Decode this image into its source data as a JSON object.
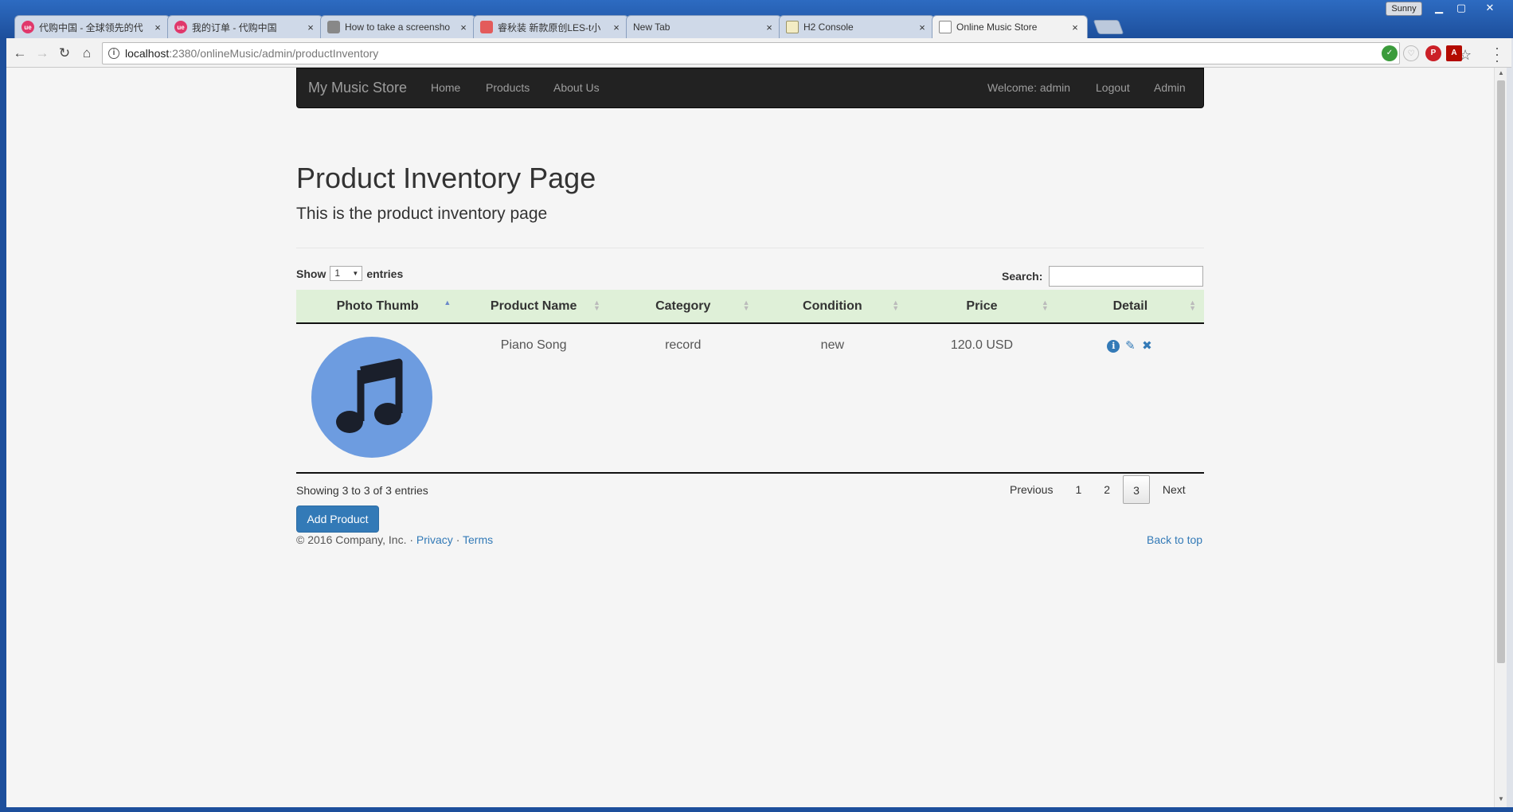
{
  "browser": {
    "tabs": [
      {
        "title": "代购中国 - 全球领先的代",
        "favicon": "red"
      },
      {
        "title": "我的订单 - 代购中国",
        "favicon": "red"
      },
      {
        "title": "How to take a screensho",
        "favicon": "grey"
      },
      {
        "title": "睿秋装 新款原创LES-t小",
        "favicon": "pink"
      },
      {
        "title": "New Tab",
        "favicon": "none"
      },
      {
        "title": "H2 Console",
        "favicon": "gdoc"
      },
      {
        "title": "Online Music Store",
        "favicon": "site",
        "active": true
      }
    ],
    "tab_close": "×",
    "user_badge": "Sunny",
    "url_host": "localhost",
    "url_rest": ":2380/onlineMusic/admin/productInventory"
  },
  "navbar": {
    "brand": "My Music Store",
    "links": [
      "Home",
      "Products",
      "About Us"
    ],
    "right_links": [
      "Welcome: admin",
      "Logout",
      "Admin"
    ]
  },
  "page": {
    "title": "Product Inventory Page",
    "lead": "This is the product inventory page"
  },
  "datatable": {
    "show_label": "Show",
    "entries_label": "entries",
    "page_length": "1",
    "search_label": "Search:",
    "search_value": "",
    "columns": [
      "Photo Thumb",
      "Product Name",
      "Category",
      "Condition",
      "Price",
      "Detail"
    ],
    "rows": [
      {
        "name": "Piano Song",
        "category": "record",
        "condition": "new",
        "price": "120.0 USD"
      }
    ],
    "info": "Showing 3 to 3 of 3 entries",
    "pagination": {
      "previous": "Previous",
      "pages": [
        "1",
        "2",
        "3"
      ],
      "current": "3",
      "next": "Next"
    }
  },
  "actions": {
    "add_product": "Add Product"
  },
  "footer": {
    "copyright": "© 2016 Company, Inc. · ",
    "privacy": "Privacy",
    "sep": " · ",
    "terms": "Terms",
    "back_to_top": "Back to top"
  },
  "colors": {
    "brand_blue": "#337ab7",
    "navbar": "#222222",
    "table_header": "#dff0d8",
    "thumb": "#6d9ce0"
  }
}
